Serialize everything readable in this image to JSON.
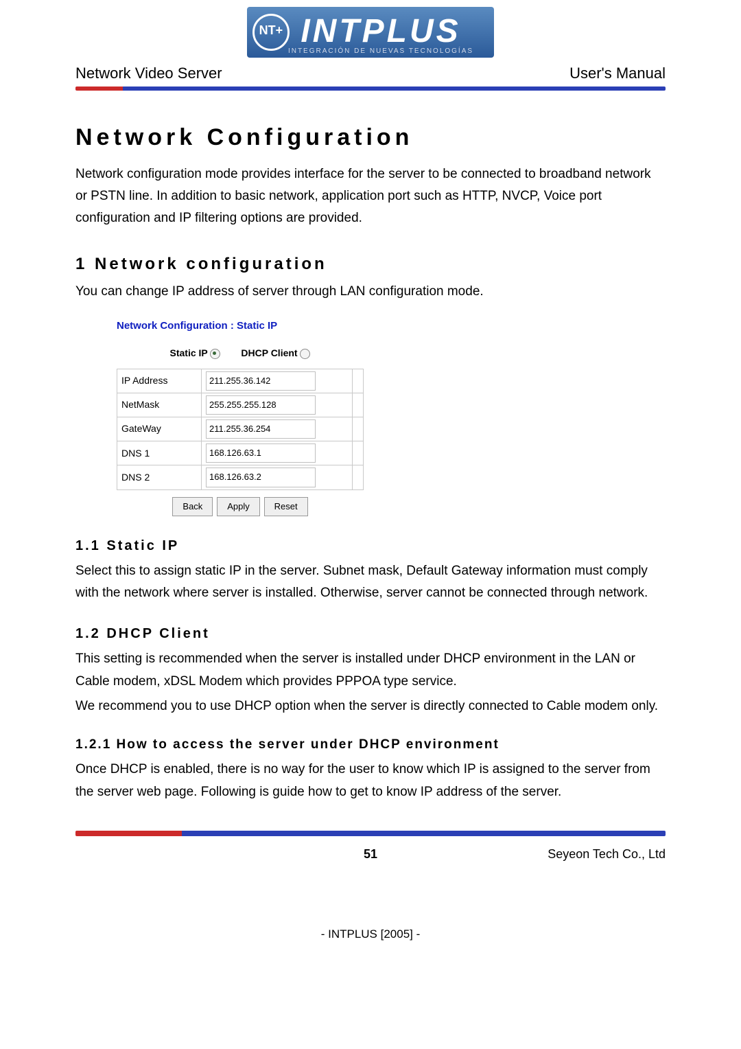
{
  "brand": {
    "name": "INTPLUS",
    "tagline": "INTEGRACIÓN DE NUEVAS TECNOLOGÍAS",
    "badge": "NT+"
  },
  "header": {
    "left": "Network Video Server",
    "right": "User's Manual"
  },
  "title": "Network Configuration",
  "intro": "Network configuration mode provides interface for the server to be connected to broadband network or PSTN line. In addition to basic network, application port such as HTTP, NVCP, Voice port configuration and IP filtering options are provided.",
  "sect1": {
    "heading": "1 Network configuration",
    "p": "You can change IP address of server through LAN configuration mode."
  },
  "panel": {
    "title": "Network Configuration : Static IP",
    "radio_static": "Static IP",
    "radio_dhcp": "DHCP Client",
    "rows": {
      "ip_label": "IP Address",
      "ip_value": "211.255.36.142",
      "mask_label": "NetMask",
      "mask_value": "255.255.255.128",
      "gw_label": "GateWay",
      "gw_value": "211.255.36.254",
      "dns1_label": "DNS 1",
      "dns1_value": "168.126.63.1",
      "dns2_label": "DNS 2",
      "dns2_value": "168.126.63.2"
    },
    "buttons": {
      "back": "Back",
      "apply": "Apply",
      "reset": "Reset"
    }
  },
  "sub11": {
    "heading": "1.1 Static IP",
    "p": "Select this to assign static IP in the server. Subnet mask, Default Gateway information must comply with the network where server is installed. Otherwise, server cannot  be connected through network."
  },
  "sub12": {
    "heading": "1.2 DHCP Client",
    "p1": "This setting is recommended when the server is installed under DHCP environment in the LAN or Cable modem, xDSL Modem which provides PPPOA type service.",
    "p2": "We recommend you to use DHCP option when the server is directly connected to Cable modem only."
  },
  "sub121": {
    "heading": "1.2.1 How to access the server under DHCP environment",
    "p": "Once DHCP is enabled, there is no way for the user to know which IP is assigned to the server from the server web page. Following is guide how to get to know IP address of the server."
  },
  "footer": {
    "page": "51",
    "company": "Seyeon Tech Co., Ltd",
    "copyright": "- INTPLUS [2005] -"
  }
}
